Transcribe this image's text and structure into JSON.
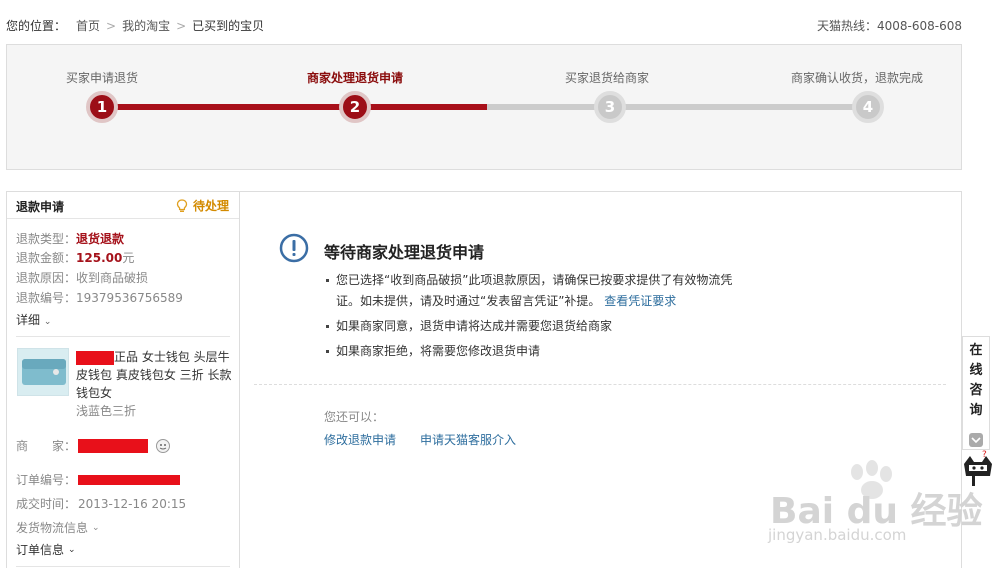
{
  "breadcrumb": {
    "label": "您的位置：",
    "items": [
      "首页",
      "我的淘宝",
      "已买到的宝贝"
    ]
  },
  "hotline": "天猫热线：4008-608-608",
  "steps": [
    {
      "label": "买家申请退货",
      "num": "1",
      "state": "done"
    },
    {
      "label": "商家处理退货申请",
      "num": "2",
      "state": "active"
    },
    {
      "label": "买家退货给商家",
      "num": "3",
      "state": "todo"
    },
    {
      "label": "商家确认收货，退款完成",
      "num": "4",
      "state": "todo"
    }
  ],
  "sidebar": {
    "title": "退款申请",
    "status": "待处理",
    "type_label": "退款类型：",
    "type_value": "退货退款",
    "amount_label": "退款金额：",
    "amount_value": "125.00",
    "amount_unit": "元",
    "reason_label": "退款原因：",
    "reason_value": "收到商品破损",
    "id_label": "退款编号：",
    "id_value": "19379536756589",
    "detail_link": "详细",
    "product_title": "正品 女士钱包 头层牛皮钱包 真皮钱包女 三折 长款钱包女",
    "product_sku": "浅蓝色三折",
    "seller_label": "商　　家：",
    "order_label": "订单编号：",
    "deal_time_label": "成交时间：",
    "deal_time_value": "2013-12-16 20:15",
    "shipping_info": "发货物流信息",
    "order_info": "订单信息"
  },
  "main": {
    "title": "等待商家处理退货申请",
    "bullet1_a": "您已选择“收到商品破损”此项退款原因，请确保已按要求提供了有效物流凭证。如未提供，请及时通过“发表留言凭证”补提。",
    "bullet1_link": "查看凭证要求",
    "bullet2": "如果商家同意，退货申请将达成并需要您退货给商家",
    "bullet3": "如果商家拒绝，将需要您修改退货申请",
    "can_do": "您还可以：",
    "action1": "修改退款申请",
    "action2": "申请天猫客服介入"
  },
  "consult": {
    "text": "在线咨询"
  },
  "watermark": {
    "main": "Bai du 经验",
    "sub": "jingyan.baidu.com"
  },
  "colors": {
    "accent": "#9c0e17",
    "link": "#2e6e9e",
    "status": "#d38a00"
  }
}
